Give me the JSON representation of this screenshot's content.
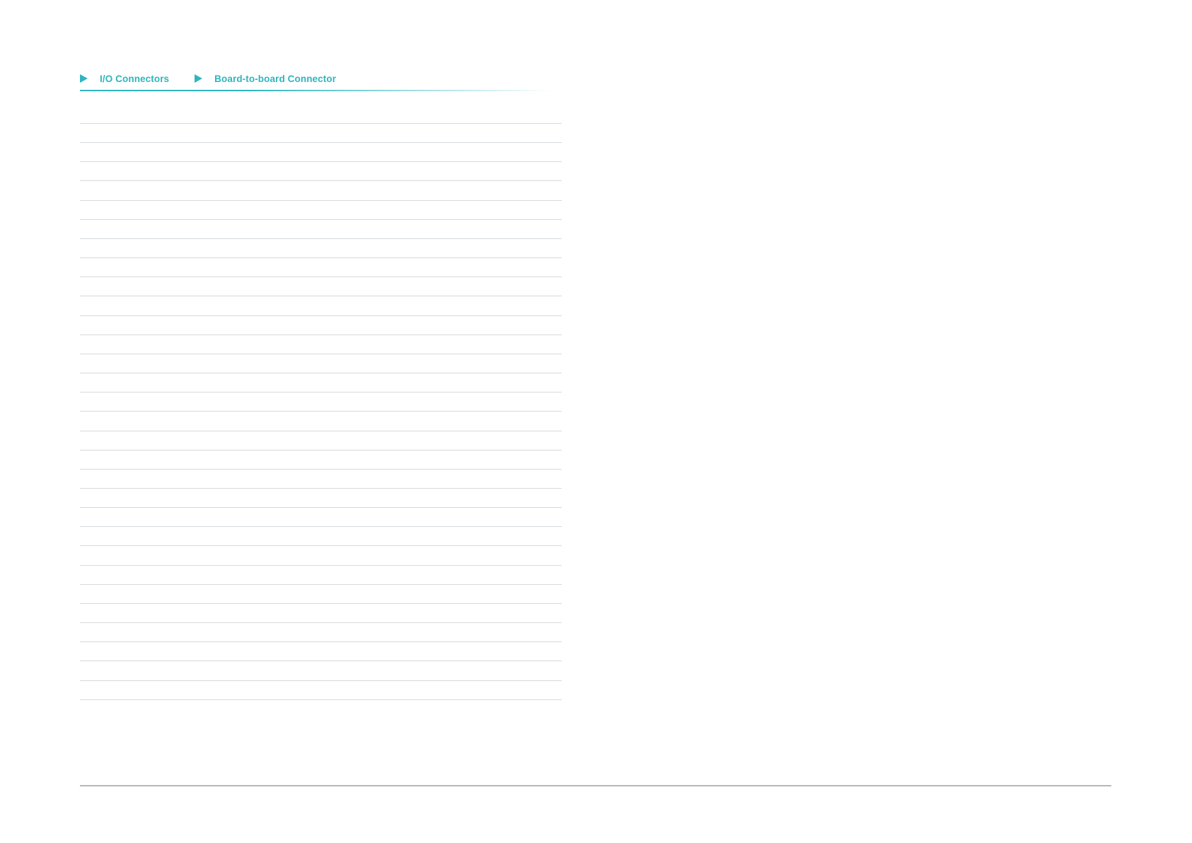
{
  "nav": {
    "items": [
      {
        "label": "I/O Connectors"
      },
      {
        "label": "Board-to-board Connector"
      }
    ]
  },
  "table": {
    "row_count": 31
  },
  "colors": {
    "accent": "#2fb5bf",
    "rule": "#d6dadd",
    "footer_rule": "#b7b7b7"
  }
}
